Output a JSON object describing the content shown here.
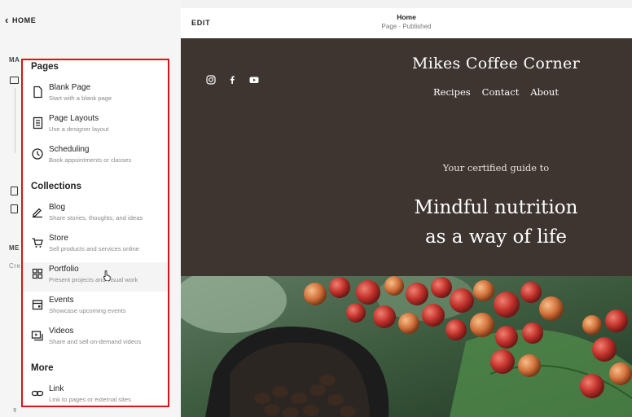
{
  "nav": {
    "home_label": "HOME"
  },
  "background_fragments": {
    "section_ma": "MA",
    "section_me": "ME",
    "section_cre": "Cre"
  },
  "add_menu": {
    "sections": [
      {
        "title": "Pages",
        "items": [
          {
            "label": "Blank Page",
            "desc": "Start with a blank page",
            "icon": "blank-page-icon"
          },
          {
            "label": "Page Layouts",
            "desc": "Use a designer layout",
            "icon": "page-layouts-icon"
          },
          {
            "label": "Scheduling",
            "desc": "Book appointments or classes",
            "icon": "clock-icon"
          }
        ]
      },
      {
        "title": "Collections",
        "items": [
          {
            "label": "Blog",
            "desc": "Share stories, thoughts, and ideas",
            "icon": "pen-icon"
          },
          {
            "label": "Store",
            "desc": "Sell products and services online",
            "icon": "cart-icon"
          },
          {
            "label": "Portfolio",
            "desc": "Present projects and visual work",
            "icon": "grid-icon"
          },
          {
            "label": "Events",
            "desc": "Showcase upcoming events",
            "icon": "calendar-icon"
          },
          {
            "label": "Videos",
            "desc": "Share and sell on-demand videos",
            "icon": "video-icon"
          }
        ]
      },
      {
        "title": "More",
        "items": [
          {
            "label": "Link",
            "desc": "Link to pages or external sites",
            "icon": "link-icon"
          }
        ]
      }
    ],
    "highlight_color": "#d7141a"
  },
  "editor": {
    "edit_label": "EDIT",
    "page_title": "Home",
    "page_status": "Page · Published"
  },
  "site": {
    "title": "Mikes Coffee Corner",
    "nav": [
      "Recipes",
      "Contact",
      "About"
    ],
    "tagline": "Your certified guide to",
    "headline_line1": "Mindful nutrition",
    "headline_line2": "as a way of life",
    "header_color": "#3e3531",
    "social_icons": [
      "instagram-icon",
      "facebook-icon",
      "youtube-icon"
    ]
  }
}
